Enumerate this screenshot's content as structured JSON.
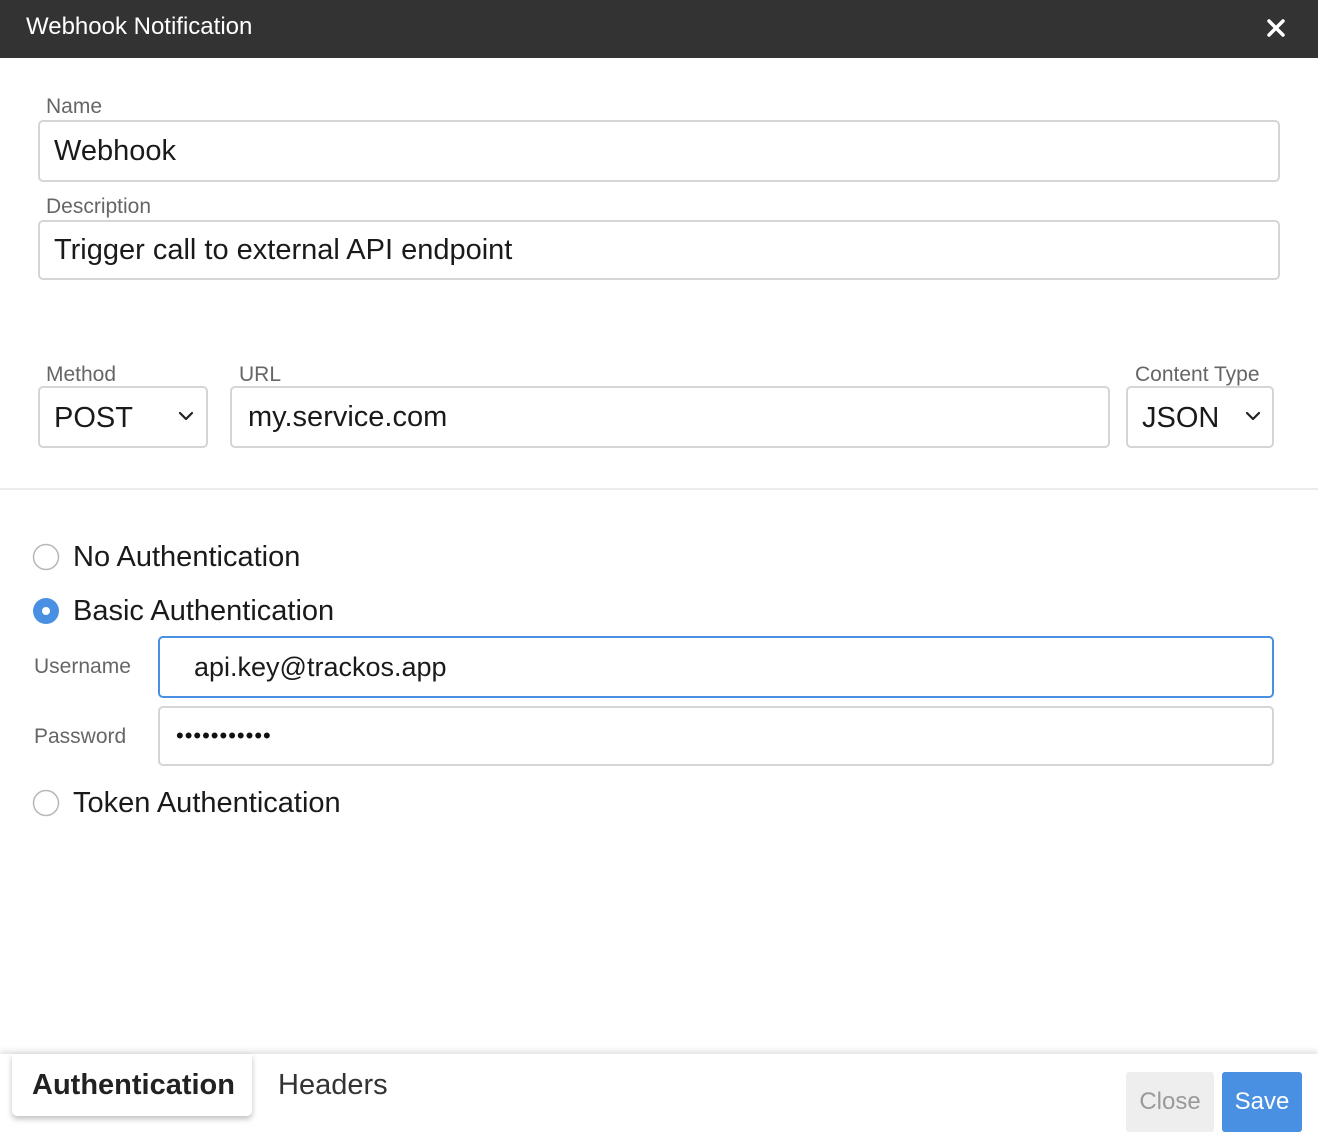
{
  "window": {
    "title": "Webhook Notification"
  },
  "form": {
    "name_label": "Name",
    "name_value": "Webhook",
    "description_label": "Description",
    "description_value": "Trigger call to external API endpoint",
    "method_label": "Method",
    "method_value": "POST",
    "url_label": "URL",
    "url_value": "my.service.com",
    "content_type_label": "Content Type",
    "content_type_value": "JSON"
  },
  "auth": {
    "options": [
      {
        "label": "No Authentication",
        "selected": false
      },
      {
        "label": "Basic Authentication",
        "selected": true
      },
      {
        "label": "Token Authentication",
        "selected": false
      }
    ],
    "username_label": "Username",
    "username_value": "api.key@trackos.app",
    "password_label": "Password",
    "password_masked": "•••••••••••"
  },
  "footer": {
    "tabs": [
      "Authentication",
      "Headers"
    ],
    "close_label": "Close",
    "save_label": "Save"
  },
  "colors": {
    "titlebar": "#333333",
    "accent": "#4a90e2",
    "input_border": "#d5d5d5"
  }
}
